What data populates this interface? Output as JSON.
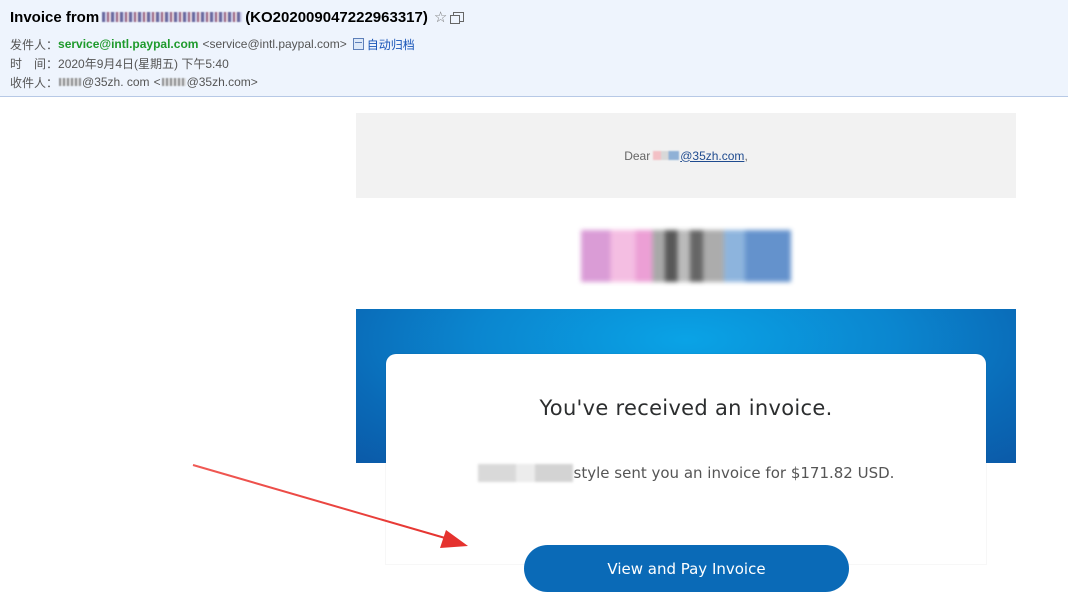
{
  "header": {
    "subject_prefix": "Invoice from",
    "subject_suffix": "(KO202009047222963317)",
    "from_label": "发件人：",
    "from_name": "service@intl.paypal.com",
    "from_address": "<service@intl.paypal.com>",
    "archive_label": "自动归档",
    "time_label": "时　间：",
    "time_value": "2020年9月4日(星期五) 下午5:40",
    "to_label": "收件人：",
    "to_name_domain": "@35zh. com",
    "to_address_prefix": "<",
    "to_address_domain": "@35zh.com>"
  },
  "email": {
    "greeting_prefix": "Dear",
    "greeting_domain": "@35zh.com",
    "greeting_suffix": ",",
    "invoice_title": "You've received an invoice.",
    "invoice_text": "style sent you an invoice for $171.82 USD.",
    "button_label": "View and Pay Invoice"
  },
  "colors": {
    "header_bg": "#eef4fd",
    "sender_green": "#1e9a2c",
    "paypal_blue": "#0a6ab7",
    "arrow_red": "#e5322e"
  }
}
